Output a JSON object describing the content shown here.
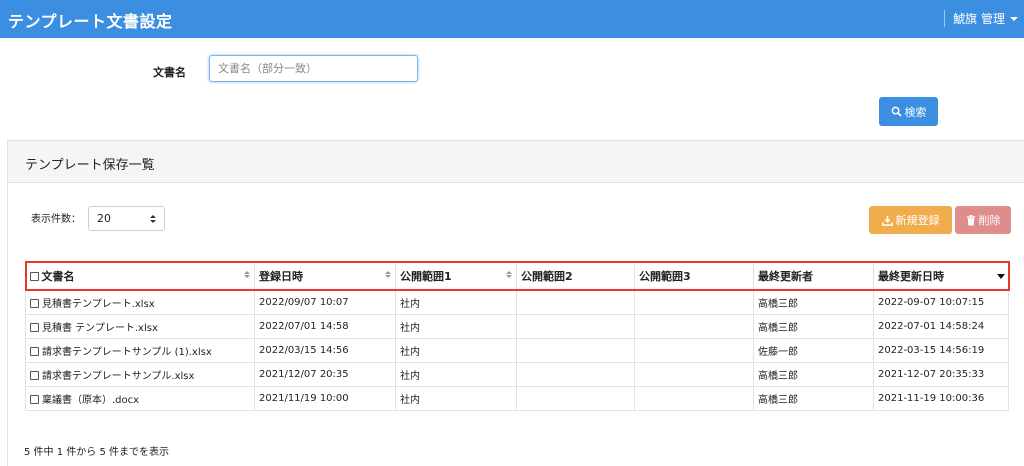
{
  "header": {
    "title": "テンプレート文書設定",
    "user": "鯱旗 管理"
  },
  "search": {
    "label": "文書名",
    "placeholder": "文書名（部分一致）",
    "button_label": "検索"
  },
  "panel": {
    "title": "テンプレート保存一覧",
    "per_page_label": "表示件数：",
    "per_page_value": "20",
    "new_button_label": "新規登録",
    "delete_button_label": "削除"
  },
  "table": {
    "columns": [
      "文書名",
      "登録日時",
      "公開範囲1",
      "公開範囲2",
      "公開範囲3",
      "最終更新者",
      "最終更新日時"
    ],
    "rows": [
      [
        "見積書テンプレート.xlsx",
        "2022/09/07 10:07",
        "社内",
        "",
        "",
        "高橋三郎",
        "2022-09-07 10:07:15"
      ],
      [
        "見積書 テンプレート.xlsx",
        "2022/07/01 14:58",
        "社内",
        "",
        "",
        "高橋三郎",
        "2022-07-01 14:58:24"
      ],
      [
        "請求書テンプレートサンプル (1).xlsx",
        "2022/03/15 14:56",
        "社内",
        "",
        "",
        "佐藤一郎",
        "2022-03-15 14:56:19"
      ],
      [
        "請求書テンプレートサンプル.xlsx",
        "2021/12/07 20:35",
        "社内",
        "",
        "",
        "高橋三郎",
        "2021-12-07 20:35:33"
      ],
      [
        "稟議書（原本）.docx",
        "2021/11/19 10:00",
        "社内",
        "",
        "",
        "高橋三郎",
        "2021-11-19 10:00:36"
      ]
    ]
  },
  "footer": {
    "count_text": "5 件中 1 件から 5 件までを表示"
  },
  "colors": {
    "primary": "#3c8ee0",
    "warning": "#f0ad4e",
    "danger": "#de8c8c",
    "highlight": "#e53a2a"
  }
}
